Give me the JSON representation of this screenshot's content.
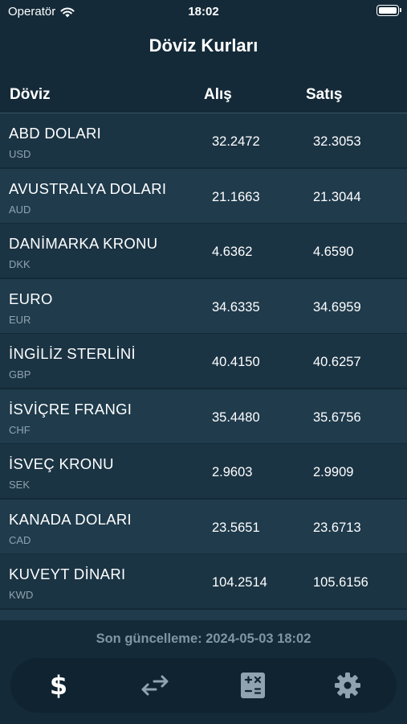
{
  "status_bar": {
    "carrier": "Operatör",
    "time": "18:02"
  },
  "nav": {
    "title": "Döviz Kurları"
  },
  "table": {
    "headers": {
      "currency": "Döviz",
      "buy": "Alış",
      "sell": "Satış"
    },
    "rows": [
      {
        "name": "ABD DOLARI",
        "code": "USD",
        "buy": "32.2472",
        "sell": "32.3053"
      },
      {
        "name": "AVUSTRALYA DOLARI",
        "code": "AUD",
        "buy": "21.1663",
        "sell": "21.3044"
      },
      {
        "name": "DANİMARKA KRONU",
        "code": "DKK",
        "buy": "4.6362",
        "sell": "4.6590"
      },
      {
        "name": "EURO",
        "code": "EUR",
        "buy": "34.6335",
        "sell": "34.6959"
      },
      {
        "name": "İNGİLİZ STERLİNİ",
        "code": "GBP",
        "buy": "40.4150",
        "sell": "40.6257"
      },
      {
        "name": "İSVİÇRE FRANGI",
        "code": "CHF",
        "buy": "35.4480",
        "sell": "35.6756"
      },
      {
        "name": "İSVEÇ KRONU",
        "code": "SEK",
        "buy": "2.9603",
        "sell": "2.9909"
      },
      {
        "name": "KANADA DOLARI",
        "code": "CAD",
        "buy": "23.5651",
        "sell": "23.6713"
      },
      {
        "name": "KUVEYT DİNARI",
        "code": "KWD",
        "buy": "104.2514",
        "sell": "105.6156"
      },
      {
        "name": "",
        "code": "",
        "buy": "",
        "sell": ""
      }
    ]
  },
  "footer": {
    "last_update": "Son güncelleme: 2024-05-03 18:02"
  },
  "tab_bar": {
    "tabs": [
      {
        "icon": "dollar-icon",
        "selected": true
      },
      {
        "icon": "convert-arrows-icon",
        "selected": false
      },
      {
        "icon": "calculator-icon",
        "selected": false
      },
      {
        "icon": "gear-icon",
        "selected": false
      }
    ]
  },
  "colors": {
    "background": "#142a38",
    "row_odd": "#1b3444",
    "row_even": "#1f3b4c",
    "muted_text": "#8fa3b0",
    "tab_bar": "#0f2330"
  }
}
